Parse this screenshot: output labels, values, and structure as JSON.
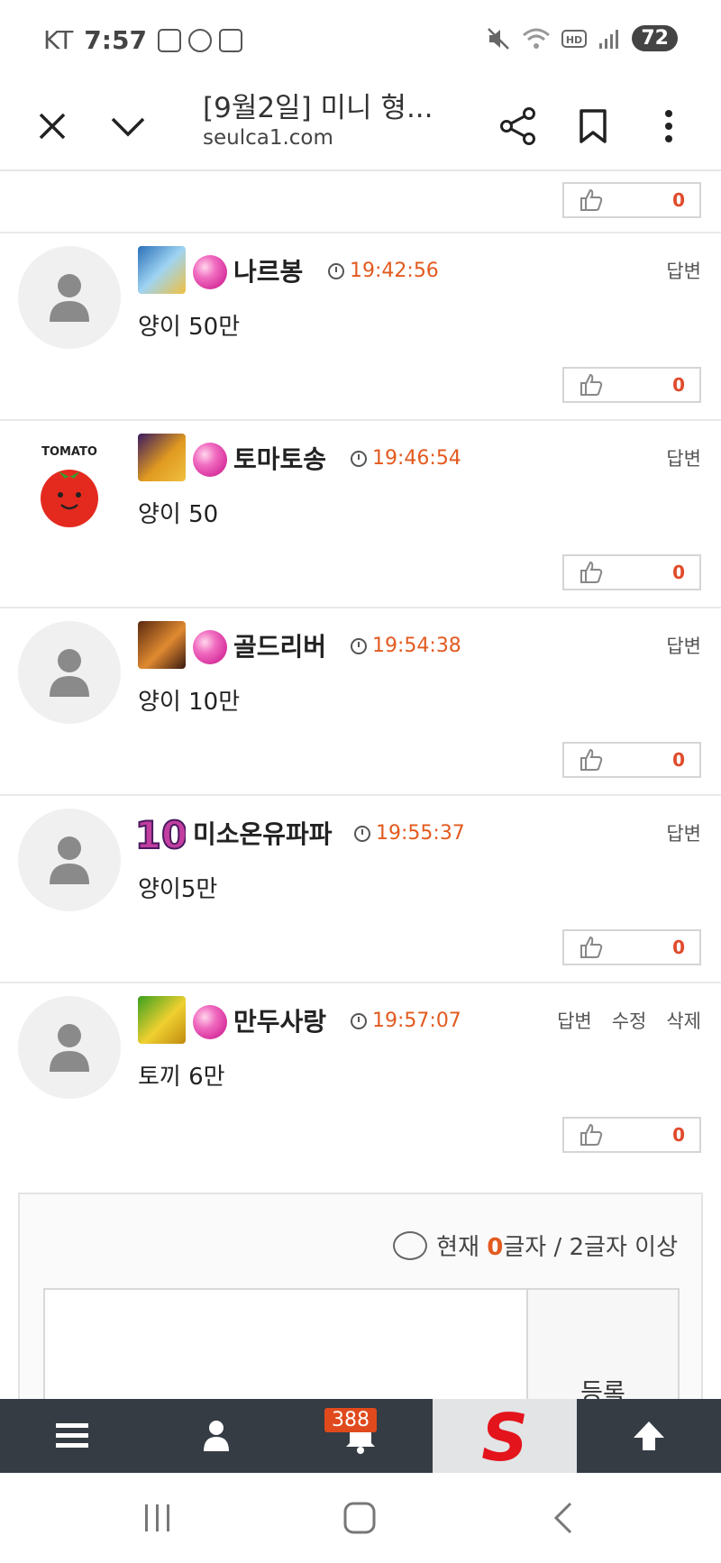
{
  "status_bar": {
    "carrier": "KT",
    "time": "7:57",
    "battery": "72",
    "icons": [
      "screenshot-icon",
      "w-app-icon",
      "calendar-icon",
      "mute-icon",
      "wifi-icon",
      "hd-icon",
      "signal-icon"
    ]
  },
  "browser": {
    "title": "[9월2일] 미니 형...",
    "url": "seulca1.com"
  },
  "top_like": {
    "count": "0"
  },
  "comments": [
    {
      "name": "나르봉",
      "time": "19:42:56",
      "text": "양이 50만",
      "reply": "답변",
      "likes": "0"
    },
    {
      "name": "토마토송",
      "time": "19:46:54",
      "text": "양이 50",
      "reply": "답변",
      "likes": "0"
    },
    {
      "name": "골드리버",
      "time": "19:54:38",
      "text": "양이 10만",
      "reply": "답변",
      "likes": "0"
    },
    {
      "name": "미소온유파파",
      "time": "19:55:37",
      "text": "양이5만",
      "reply": "답변",
      "likes": "0"
    },
    {
      "name": "만두사랑",
      "time": "19:57:07",
      "text": "토끼 6만",
      "reply": "답변",
      "edit": "수정",
      "delete": "삭제",
      "likes": "0"
    }
  ],
  "tomato_avatar": {
    "label": "TOMATO"
  },
  "badge_10": {
    "label": "10"
  },
  "editor": {
    "counter_prefix": "현재 ",
    "counter_value": "0",
    "counter_suffix": "글자 / 2글자 이상",
    "submit": "등록"
  },
  "bottom_nav": {
    "notification_count": "388",
    "logo_letter": "S"
  },
  "colors": {
    "accent_orange": "#e25a1f",
    "nav_bg": "#353c44",
    "like_red": "#e04a2a"
  }
}
